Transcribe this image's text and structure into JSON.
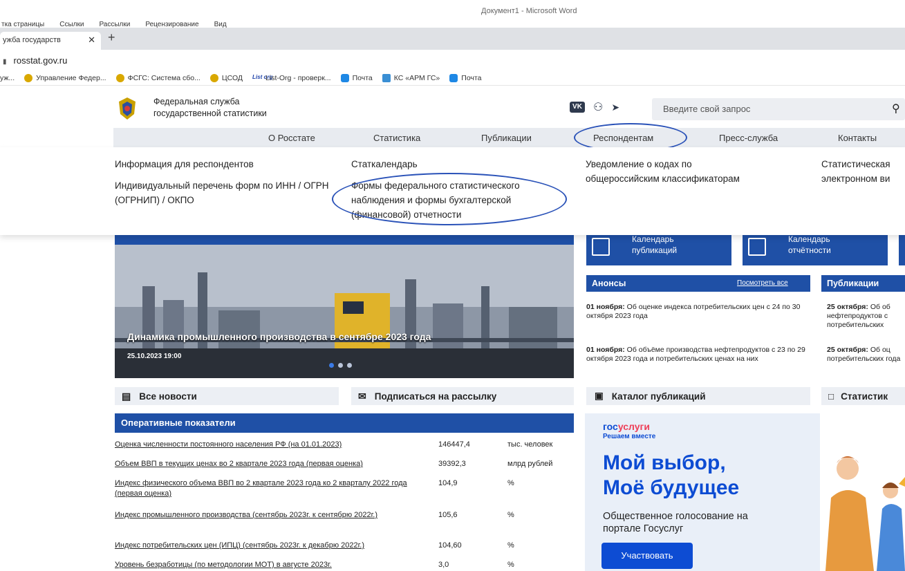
{
  "word": {
    "title": "Документ1  -  Microsoft Word",
    "menu": [
      "тка страницы",
      "Ссылки",
      "Рассылки",
      "Рецензирование",
      "Вид"
    ]
  },
  "browser": {
    "tab_title": "ужба государств",
    "tab_close": "✕",
    "new_tab": "+",
    "address": "rosstat.gov.ru",
    "bookmarks": [
      {
        "label": "уж...",
        "icon": "none"
      },
      {
        "label": "Управление Федер...",
        "icon": "emblem-icon"
      },
      {
        "label": "ФСГС: Система сбо...",
        "icon": "emblem-icon"
      },
      {
        "label": "ЦСОД",
        "icon": "emblem-icon"
      },
      {
        "label": "List-Org - проверк...",
        "icon": "list-org-icon"
      },
      {
        "label": "Почта",
        "icon": "mail-icon"
      },
      {
        "label": "КС «АРМ ГС»",
        "icon": "ks-icon"
      },
      {
        "label": "Почта",
        "icon": "mail-icon"
      }
    ],
    "list_icon_text": "List org"
  },
  "header": {
    "org_line1": "Федеральная служба",
    "org_line2": "государственной статистики",
    "vk": "VK",
    "search_placeholder": "Введите свой запрос"
  },
  "nav": {
    "items": [
      "О Росстате",
      "Статистика",
      "Публикации",
      "Респондентам",
      "Пресс-служба",
      "Контакты"
    ]
  },
  "dropdown": {
    "col1": [
      "Информация для респондентов",
      "Индивидуальный перечень форм по ИНН / ОГРН (ОГРНИП) / ОКПО"
    ],
    "col2": [
      "Статкалендарь",
      "Формы федерального статистического наблюдения и формы бухгалтерской (финансовой) отчетности"
    ],
    "col3": [
      "Уведомление о кодах по общероссийским классификаторам"
    ],
    "col4": [
      "Статистическая",
      "электронном ви"
    ]
  },
  "news": {
    "title": "Динамика промышленного производства в сентябре 2023 года",
    "date": "25.10.2023 19:00",
    "slides": 3,
    "active_slide": 1
  },
  "buttons": {
    "all_news": "Все новости",
    "subscribe": "Подписаться на рассылку",
    "catalog": "Каталог публикаций",
    "stat": "Статистик"
  },
  "indicators": {
    "header": "Оперативные показатели",
    "rows": [
      {
        "name": "Оценка численности постоянного населения РФ (на 01.01.2023)",
        "value": "146447,4",
        "unit": "тыс. человек"
      },
      {
        "name": "Объем ВВП в текущих ценах во 2 квартале 2023 года (первая оценка)",
        "value": "39392,3",
        "unit": "млрд рублей"
      },
      {
        "name": "Индекс физического объема ВВП во 2 квартале 2023 года ко 2 кварталу 2022 года (первая оценка)",
        "value": "104,9",
        "unit": "%"
      },
      {
        "name": "Индекс промышленного производства (сентябрь 2023г. к сентябрю 2022г.)",
        "value": "105,6",
        "unit": "%"
      },
      {
        "name": "Индекс потребительских цен (ИПЦ) (сентябрь 2023г. к декабрю 2022г.)",
        "value": "104,60",
        "unit": "%"
      },
      {
        "name": "Уровень безработицы (по методологии МОТ) в августе 2023г.",
        "value": "3,0",
        "unit": "%"
      }
    ]
  },
  "calendars": {
    "pub": "Календарь публикаций",
    "rep": "Календарь отчётности"
  },
  "announcements": {
    "header": "Анонсы",
    "see_all": "Посмотреть все",
    "items": [
      {
        "date": "01 ноября:",
        "text": "Об оценке индекса потребительских цен с 24 по 30 октября 2023 года"
      },
      {
        "date": "01 ноября:",
        "text": "Об объёме производства нефтепродуктов с 23 по 29 октября 2023 года и потребительских ценах на них"
      }
    ]
  },
  "publications": {
    "header": "Публикации",
    "items": [
      {
        "date": "25 октября:",
        "text": "Об об нефтепродуктов с потребительских"
      },
      {
        "date": "25 октября:",
        "text": "Об оц потребительских года"
      }
    ]
  },
  "gosuslugi": {
    "logo_a": "гос",
    "logo_b": "услуги",
    "tagline": "Решаем вместе",
    "headline1": "Мой выбор,",
    "headline2": "Моё будущее",
    "text1": "Общественное голосование на",
    "text2": "портале Госуслуг",
    "button": "Участвовать"
  },
  "colors": {
    "accent": "#1f50a6",
    "gos_blue": "#0d4cd3",
    "annotation": "#2a52b8"
  }
}
